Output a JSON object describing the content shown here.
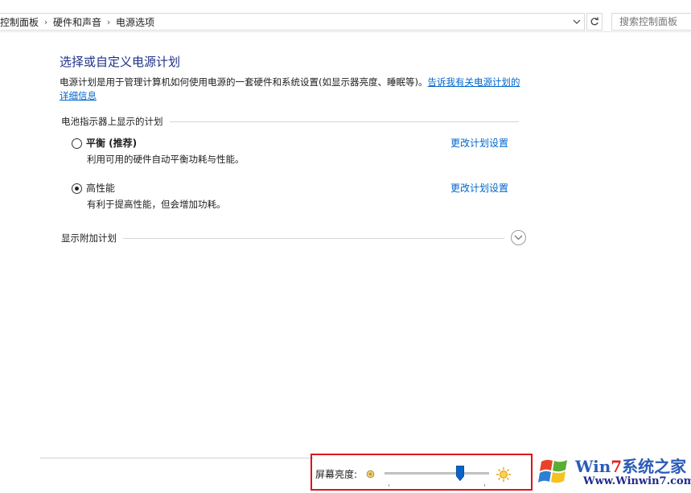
{
  "address_bar": {
    "breadcrumbs": [
      "控制面板",
      "硬件和声音",
      "电源选项"
    ],
    "search_placeholder": "搜索控制面板"
  },
  "main": {
    "title": "选择或自定义电源计划",
    "description": "电源计划是用于管理计算机如何使用电源的一套硬件和系统设置(如显示器亮度、睡眠等)。",
    "description_link": "告诉我有关电源计划的详细信息",
    "battery_group_label": "电池指示器上显示的计划",
    "plans": [
      {
        "name": "平衡 (推荐)",
        "description": "利用可用的硬件自动平衡功耗与性能。",
        "link": "更改计划设置",
        "selected": false
      },
      {
        "name": "高性能",
        "description": "有利于提高性能，但会增加功耗。",
        "link": "更改计划设置",
        "selected": true
      }
    ],
    "additional_plans_label": "显示附加计划"
  },
  "brightness": {
    "label": "屏幕亮度:",
    "level": 0.72
  },
  "watermark": {
    "title_win": "Win",
    "title_7": "7",
    "title_rest": "系统之家",
    "url": "Www.Winwin7.com"
  },
  "colors": {
    "title_blue": "#1e3287",
    "link_blue": "#0066cc",
    "highlight_red": "#e0101a",
    "slider_blue": "#0a64c8"
  }
}
